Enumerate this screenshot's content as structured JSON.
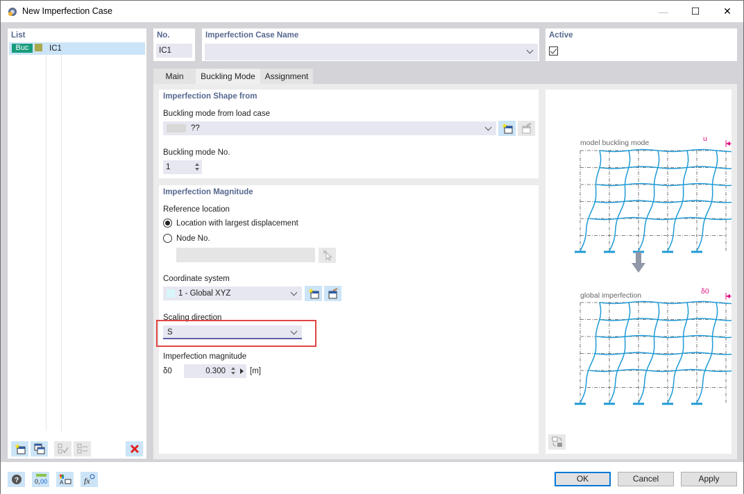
{
  "window": {
    "title": "New Imperfection Case",
    "controls": {
      "minimize": "—",
      "maximize": "☐",
      "close": "✕"
    }
  },
  "list": {
    "title": "List",
    "items": [
      {
        "badge": "Buc",
        "badge_color": "#179c7d",
        "swatch_color": "#a9a84a",
        "name": "IC1"
      }
    ]
  },
  "header": {
    "no_label": "No.",
    "no_value": "IC1",
    "name_label": "Imperfection Case Name",
    "name_value": "",
    "active_label": "Active",
    "active_checked": true
  },
  "tabs": [
    {
      "label": "Main",
      "active": false
    },
    {
      "label": "Buckling Mode",
      "active": true
    },
    {
      "label": "Assignment",
      "active": false
    }
  ],
  "shape": {
    "title": "Imperfection Shape from",
    "load_case_label": "Buckling mode from load case",
    "load_case_value": "??",
    "mode_no_label": "Buckling mode No.",
    "mode_no_value": "1"
  },
  "magnitude": {
    "title": "Imperfection Magnitude",
    "ref_location_label": "Reference location",
    "options": [
      {
        "label": "Location with largest displacement",
        "checked": true
      },
      {
        "label": "Node No.",
        "checked": false
      }
    ],
    "node_value": "",
    "coord_label": "Coordinate system",
    "coord_value": "1 - Global XYZ",
    "coord_swatch": "#d9f6fb",
    "scaling_label": "Scaling direction",
    "scaling_value": "S",
    "imp_mag_label": "Imperfection magnitude",
    "symbol": "δ0",
    "value": "0.300",
    "unit": "[m]"
  },
  "illustration": {
    "top_caption": "model buckling mode",
    "top_dim": "u",
    "bottom_caption": "global imperfection",
    "bottom_dim": "δ0",
    "frame_color": "#1e9ad6",
    "dim_color": "#e0107f"
  },
  "buttons": {
    "ok": "OK",
    "cancel": "Cancel",
    "apply": "Apply"
  }
}
